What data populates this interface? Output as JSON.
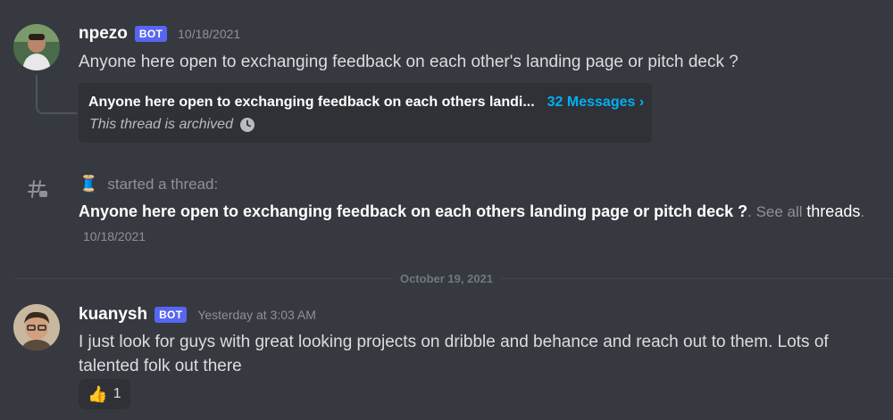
{
  "messages": [
    {
      "username": "npezo",
      "badge": "BOT",
      "timestamp": "10/18/2021",
      "text": "Anyone here open to exchanging feedback on each other's landing page or pitch deck ?",
      "thread": {
        "title": "Anyone here open to exchanging feedback on each others landi...",
        "count_label": "32 Messages",
        "chevron": "›",
        "status": "This thread is archived"
      }
    },
    {
      "username": "kuanysh",
      "badge": "BOT",
      "timestamp": "Yesterday at 3:03 AM",
      "text_line1": "I just look for guys with great looking projects on dribble and behance and reach out to them. Lots of",
      "text_line2": "talented folk out there",
      "reaction": {
        "emoji": "👍",
        "count": "1"
      }
    }
  ],
  "system_message": {
    "icon": "thread-hash-icon",
    "emoji": "🧵",
    "action": "started a thread:",
    "thread_name": "Anyone here open to exchanging feedback on each others landing page or pitch deck ?",
    "see_all_prefix": ". See all ",
    "see_all_link": "threads",
    "see_all_suffix": ".",
    "timestamp": "10/18/2021"
  },
  "date_divider": "October 19, 2021",
  "colors": {
    "background": "#36393f",
    "bot_badge": "#5865f2",
    "link": "#00aff4"
  }
}
